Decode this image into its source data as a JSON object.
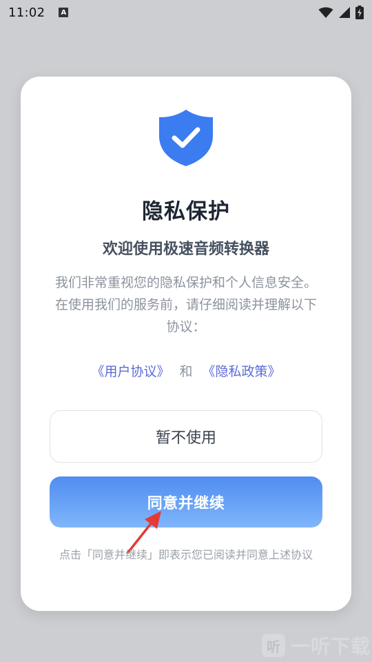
{
  "status_bar": {
    "time": "11:02",
    "notification_icon_letter": "A",
    "icons": [
      "wifi-icon",
      "signal-icon",
      "battery-charging-icon"
    ]
  },
  "dialog": {
    "icon": "shield-check-icon",
    "title": "隐私保护",
    "subtitle": "欢迎使用极速音频转换器",
    "description": "我们非常重视您的隐私保护和个人信息安全。在使用我们的服务前，请仔细阅读并理解以下协议：",
    "user_agreement_link": "《用户协议》",
    "and_text": "和",
    "privacy_policy_link": "《隐私政策》",
    "decline_label": "暂不使用",
    "accept_label": "同意并继续",
    "notice": "点击「同意并继续」即表示您已阅读并同意上述协议"
  },
  "watermark": {
    "logo_char": "听",
    "text": "一听下载"
  },
  "colors": {
    "shield": "#3b7cf0",
    "link": "#5b6bd6",
    "accept_top": "#4f8df0",
    "accept_bottom": "#80b6fb",
    "arrow": "#e53935"
  }
}
